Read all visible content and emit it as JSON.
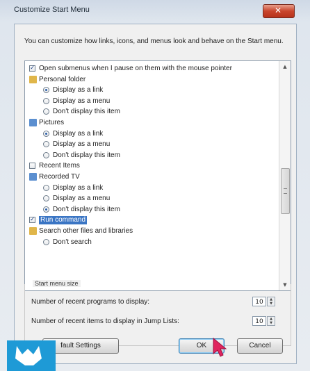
{
  "window": {
    "title": "Customize Start Menu",
    "close_glyph": "✕"
  },
  "description": "You can customize how links, icons, and menus look and behave on the Start menu.",
  "options": [
    {
      "type": "checkbox",
      "checked": true,
      "indent": 0,
      "label": "Open submenus when I pause on them with the mouse pointer"
    },
    {
      "type": "folder",
      "icon": "personal-folder-icon",
      "indent": 0,
      "label": "Personal folder"
    },
    {
      "type": "radio",
      "checked": true,
      "indent": 1,
      "label": "Display as a link"
    },
    {
      "type": "radio",
      "checked": false,
      "indent": 1,
      "label": "Display as a menu"
    },
    {
      "type": "radio",
      "checked": false,
      "indent": 1,
      "label": "Don't display this item"
    },
    {
      "type": "folder",
      "icon": "pictures-icon",
      "indent": 0,
      "label": "Pictures"
    },
    {
      "type": "radio",
      "checked": true,
      "indent": 1,
      "label": "Display as a link"
    },
    {
      "type": "radio",
      "checked": false,
      "indent": 1,
      "label": "Display as a menu"
    },
    {
      "type": "radio",
      "checked": false,
      "indent": 1,
      "label": "Don't display this item"
    },
    {
      "type": "checkbox",
      "checked": false,
      "indent": 0,
      "label": "Recent Items"
    },
    {
      "type": "folder",
      "icon": "recorded-tv-icon",
      "indent": 0,
      "label": "Recorded TV"
    },
    {
      "type": "radio",
      "checked": false,
      "indent": 1,
      "label": "Display as a link"
    },
    {
      "type": "radio",
      "checked": false,
      "indent": 1,
      "label": "Display as a menu"
    },
    {
      "type": "radio",
      "checked": true,
      "indent": 1,
      "label": "Don't display this item"
    },
    {
      "type": "checkbox",
      "checked": true,
      "indent": 0,
      "label": "Run command",
      "selected": true
    },
    {
      "type": "folder",
      "icon": "search-folder-icon",
      "indent": 0,
      "label": "Search other files and libraries"
    },
    {
      "type": "radio",
      "checked": false,
      "indent": 1,
      "label": "Don't search"
    }
  ],
  "start_menu_size": {
    "label": "Start menu size",
    "recent_programs_label": "Number of recent programs to display:",
    "recent_programs_value": "10",
    "recent_items_label": "Number of recent items to display in Jump Lists:",
    "recent_items_value": "10"
  },
  "buttons": {
    "defaults": "fault Settings",
    "ok": "OK",
    "cancel": "Cancel"
  },
  "colors": {
    "accent": "#3a75c4",
    "close": "#c9452c",
    "logo": "#1e9ad6",
    "cursor": "#e0245e"
  }
}
